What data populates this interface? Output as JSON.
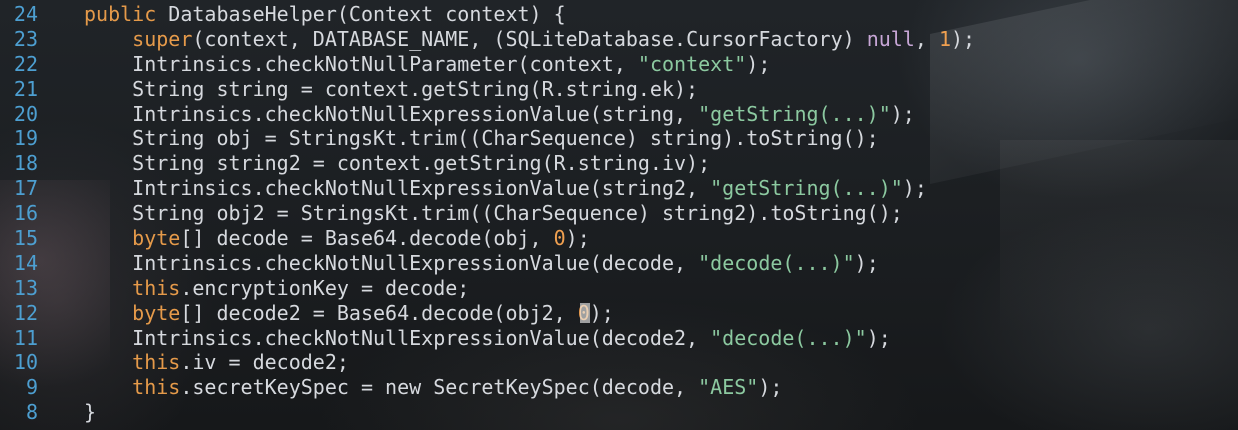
{
  "editor": {
    "lines": [
      {
        "num": "24",
        "indent": 1,
        "parts": [
          {
            "k": "kw",
            "t": "public"
          },
          {
            "k": "",
            "t": " DatabaseHelper(Context context) {"
          }
        ]
      },
      {
        "num": "23",
        "indent": 2,
        "parts": [
          {
            "k": "kw",
            "t": "super"
          },
          {
            "k": "",
            "t": "(context, DATABASE_NAME, (SQLiteDatabase.CursorFactory) "
          },
          {
            "k": "nul",
            "t": "null"
          },
          {
            "k": "",
            "t": ", "
          },
          {
            "k": "num",
            "t": "1"
          },
          {
            "k": "",
            "t": ");"
          }
        ]
      },
      {
        "num": "22",
        "indent": 2,
        "parts": [
          {
            "k": "",
            "t": "Intrinsics.checkNotNullParameter(context, "
          },
          {
            "k": "str",
            "t": "\"context\""
          },
          {
            "k": "",
            "t": ");"
          }
        ]
      },
      {
        "num": "21",
        "indent": 2,
        "parts": [
          {
            "k": "",
            "t": "String string = context.getString(R.string.ek);"
          }
        ]
      },
      {
        "num": "20",
        "indent": 2,
        "parts": [
          {
            "k": "",
            "t": "Intrinsics.checkNotNullExpressionValue(string, "
          },
          {
            "k": "str",
            "t": "\"getString(...)\""
          },
          {
            "k": "",
            "t": ");"
          }
        ]
      },
      {
        "num": "19",
        "indent": 2,
        "parts": [
          {
            "k": "",
            "t": "String obj = StringsKt.trim((CharSequence) string).toString();"
          }
        ]
      },
      {
        "num": "18",
        "indent": 2,
        "parts": [
          {
            "k": "",
            "t": "String string2 = context.getString(R.string.iv);"
          }
        ]
      },
      {
        "num": "17",
        "indent": 2,
        "parts": [
          {
            "k": "",
            "t": "Intrinsics.checkNotNullExpressionValue(string2, "
          },
          {
            "k": "str",
            "t": "\"getString(...)\""
          },
          {
            "k": "",
            "t": ");"
          }
        ]
      },
      {
        "num": "16",
        "indent": 2,
        "parts": [
          {
            "k": "",
            "t": "String obj2 = StringsKt.trim((CharSequence) string2).toString();"
          }
        ]
      },
      {
        "num": "15",
        "indent": 2,
        "parts": [
          {
            "k": "kw",
            "t": "byte"
          },
          {
            "k": "",
            "t": "[] decode = Base64.decode(obj, "
          },
          {
            "k": "num",
            "t": "0"
          },
          {
            "k": "",
            "t": ");"
          }
        ]
      },
      {
        "num": "14",
        "indent": 2,
        "parts": [
          {
            "k": "",
            "t": "Intrinsics.checkNotNullExpressionValue(decode, "
          },
          {
            "k": "str",
            "t": "\"decode(...)\""
          },
          {
            "k": "",
            "t": ");"
          }
        ]
      },
      {
        "num": "13",
        "indent": 2,
        "parts": [
          {
            "k": "kw",
            "t": "this"
          },
          {
            "k": "",
            "t": ".encryptionKey = decode;"
          }
        ]
      },
      {
        "num": "12",
        "indent": 2,
        "parts": [
          {
            "k": "kw",
            "t": "byte"
          },
          {
            "k": "",
            "t": "[] decode2 = Base64.decode(obj2, "
          },
          {
            "k": "num",
            "t": "0"
          },
          {
            "k": "cursor",
            "t": ""
          },
          {
            "k": "",
            "t": ");"
          }
        ]
      },
      {
        "num": "11",
        "indent": 2,
        "parts": [
          {
            "k": "",
            "t": "Intrinsics.checkNotNullExpressionValue(decode2, "
          },
          {
            "k": "str",
            "t": "\"decode(...)\""
          },
          {
            "k": "",
            "t": ");"
          }
        ]
      },
      {
        "num": "10",
        "indent": 2,
        "parts": [
          {
            "k": "kw",
            "t": "this"
          },
          {
            "k": "",
            "t": ".iv = decode2;"
          }
        ]
      },
      {
        "num": "9",
        "indent": 2,
        "parts": [
          {
            "k": "kw",
            "t": "this"
          },
          {
            "k": "",
            "t": ".secretKeySpec = new SecretKeySpec(decode, "
          },
          {
            "k": "str",
            "t": "\"AES\""
          },
          {
            "k": "",
            "t": ");"
          }
        ]
      },
      {
        "num": "8",
        "indent": 1,
        "parts": [
          {
            "k": "",
            "t": "}"
          }
        ]
      }
    ]
  },
  "colors": {
    "line_number": "#4d9fd1",
    "keyword": "#e59a4a",
    "string": "#8cc9a0",
    "number": "#f0a050",
    "null_literal": "#c7a6d6",
    "text": "#d6d9de"
  }
}
